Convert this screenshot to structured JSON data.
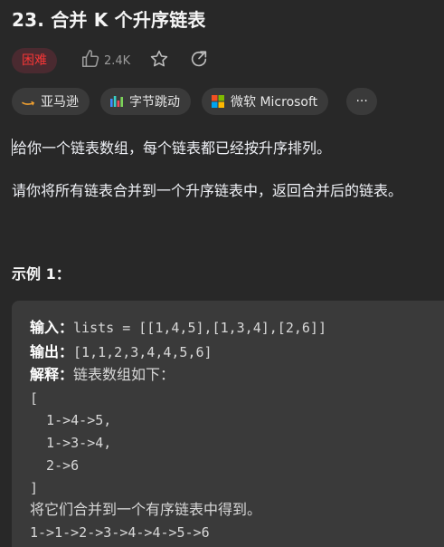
{
  "problem": {
    "title": "23. 合并 K 个升序链表",
    "difficulty": "困难",
    "likes": "2.4K",
    "difficulty_color": "#f63636"
  },
  "tags": [
    {
      "label": "亚马逊",
      "icon": "amazon-icon"
    },
    {
      "label": "字节跳动",
      "icon": "bytedance-icon"
    },
    {
      "label": "微软 Microsoft",
      "icon": "microsoft-icon"
    }
  ],
  "more_label": "···",
  "description": {
    "p1": "给你一个链表数组，每个链表都已经按升序排列。",
    "p2": "请你将所有链表合并到一个升序链表中，返回合并后的链表。"
  },
  "example": {
    "title": "示例 1：",
    "input_label": "输入：",
    "input_value": "lists = [[1,4,5],[1,3,4],[2,6]]",
    "output_label": "输出：",
    "output_value": "[1,1,2,3,4,4,5,6]",
    "explain_label": "解释：",
    "explain_text": "链表数组如下：",
    "lines": [
      "[",
      "  1->4->5,",
      "  1->3->4,",
      "  2->6",
      "]"
    ],
    "merge_text": "将它们合并到一个有序链表中得到。",
    "result": "1->1->2->3->4->4->5->6"
  }
}
